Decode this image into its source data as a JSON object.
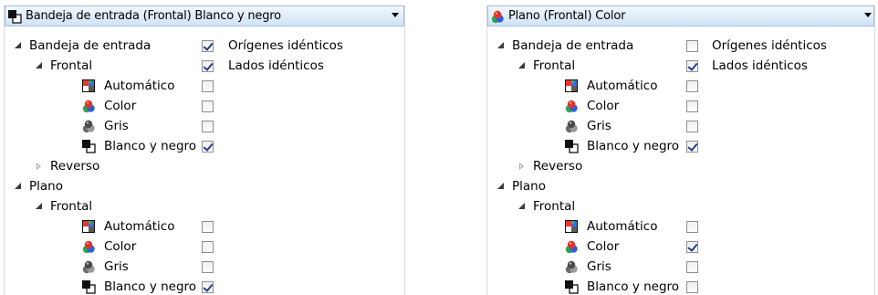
{
  "left": {
    "dropdown_label": "Bandeja de entrada (Frontal) Blanco y negro",
    "dropdown_icon": "black-white-icon",
    "tree": {
      "bandeja": "Bandeja de entrada",
      "bandeja_option": "Orígenes idénticos",
      "bandeja_option_checked": true,
      "frontal1": "Frontal",
      "frontal1_option": "Lados idénticos",
      "frontal1_option_checked": true,
      "auto1": "Automático",
      "auto1_checked": false,
      "color1": "Color",
      "color1_checked": false,
      "gris1": "Gris",
      "gris1_checked": false,
      "byn1": "Blanco y negro",
      "byn1_checked": true,
      "reverso": "Reverso",
      "plano": "Plano",
      "frontal2": "Frontal",
      "auto2": "Automático",
      "auto2_checked": false,
      "color2": "Color",
      "color2_checked": false,
      "gris2": "Gris",
      "gris2_checked": false,
      "byn2": "Blanco y negro",
      "byn2_checked": true
    }
  },
  "right": {
    "dropdown_label": "Plano (Frontal) Color",
    "dropdown_icon": "color-icon",
    "tree": {
      "bandeja": "Bandeja de entrada",
      "bandeja_option": "Orígenes idénticos",
      "bandeja_option_checked": false,
      "frontal1": "Frontal",
      "frontal1_option": "Lados idénticos",
      "frontal1_option_checked": true,
      "auto1": "Automático",
      "auto1_checked": false,
      "color1": "Color",
      "color1_checked": false,
      "gris1": "Gris",
      "gris1_checked": false,
      "byn1": "Blanco y negro",
      "byn1_checked": true,
      "reverso": "Reverso",
      "plano": "Plano",
      "frontal2": "Frontal",
      "auto2": "Automático",
      "auto2_checked": false,
      "color2": "Color",
      "color2_checked": true,
      "gris2": "Gris",
      "gris2_checked": false,
      "byn2": "Blanco y negro",
      "byn2_checked": false
    }
  }
}
